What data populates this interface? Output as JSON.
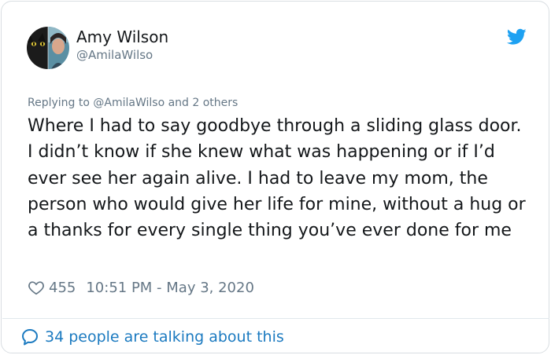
{
  "tweet": {
    "author_name": "Amy Wilson",
    "author_handle": "@AmilaWilso",
    "replying_prefix": "Replying to",
    "replying_handle": "@AmilaWilso",
    "replying_suffix": "and 2 others",
    "text": "Where I had to say goodbye through a sliding glass door. I didn’t know if she knew what was happening or if I’d ever see her again alive. I had to leave my mom, the person who would give her life for mine, without a hug or a thanks for every single thing you’ve ever done for me",
    "likes": "455",
    "timestamp": "10:51 PM - May 3, 2020",
    "talking_about": "34 people are talking about this"
  },
  "icons": {
    "brand": "twitter-bird-icon",
    "like": "heart-outline-icon",
    "reply": "speech-bubble-icon"
  },
  "colors": {
    "twitter_blue": "#1da1f2",
    "link_blue": "#1b7ac0",
    "secondary_text": "#657786",
    "primary_text": "#14171a"
  }
}
